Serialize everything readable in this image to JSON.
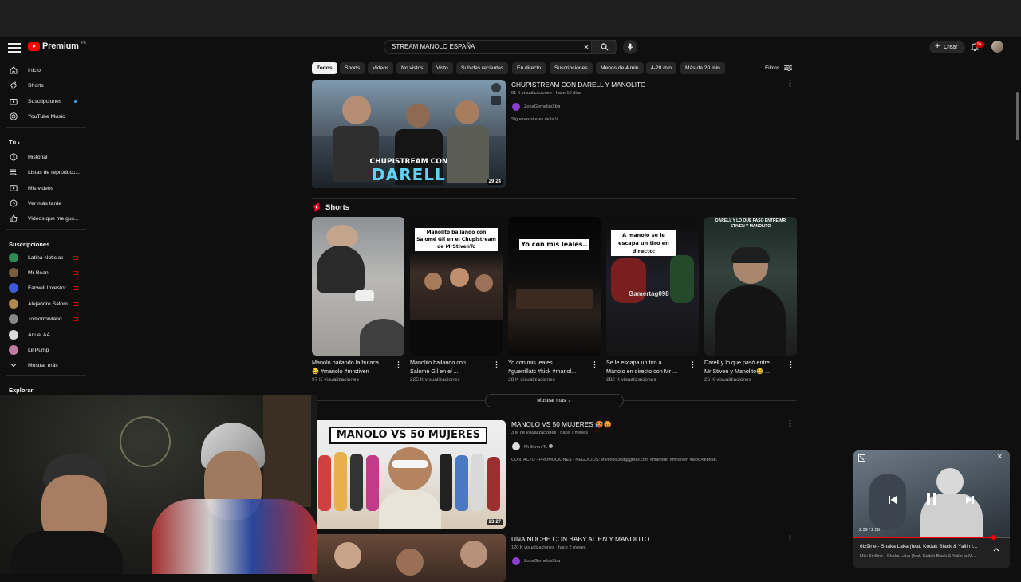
{
  "header": {
    "logo_text": "Premium",
    "country_code": "PE",
    "search_value": "STREAM MANOLO ESPAÑA",
    "create_label": "Crear",
    "notification_count": "9+"
  },
  "sidebar": {
    "main": [
      {
        "label": "Inicio",
        "icon": "home-icon"
      },
      {
        "label": "Shorts",
        "icon": "shorts-icon"
      },
      {
        "label": "Suscripciones",
        "icon": "subscriptions-icon"
      },
      {
        "label": "YouTube Music",
        "icon": "music-icon"
      }
    ],
    "you_heading": "Tú",
    "you": [
      {
        "label": "Historial",
        "icon": "history-icon"
      },
      {
        "label": "Listas de reproducc...",
        "icon": "playlists-icon"
      },
      {
        "label": "Mis videos",
        "icon": "my-videos-icon"
      },
      {
        "label": "Ver más tarde",
        "icon": "watch-later-icon"
      },
      {
        "label": "Videos que me gus...",
        "icon": "liked-icon"
      }
    ],
    "subs_heading": "Suscripciones",
    "subscriptions": [
      {
        "label": "Latina Noticias",
        "color": "#2e8b57"
      },
      {
        "label": "Mr Bean",
        "color": "#7a5c3e"
      },
      {
        "label": "Farwell Investor",
        "color": "#3b5bdb"
      },
      {
        "label": "Alejandro Salom...",
        "color": "#b08a4a"
      },
      {
        "label": "Tomorrowland",
        "color": "#888888"
      },
      {
        "label": "Anuel AA",
        "color": "#d9d9d9"
      },
      {
        "label": "Lil Pump",
        "color": "#c27aa0"
      }
    ],
    "show_more": "Mostrar más",
    "explore_heading": "Explorar"
  },
  "chips": [
    "Todos",
    "Shorts",
    "Videos",
    "No vistos",
    "Visto",
    "Subidas recientes",
    "En directo",
    "Suscripciones",
    "Menos de 4 min",
    "4-20 min",
    "Más de 20 min"
  ],
  "filters_label": "Filtros",
  "results": [
    {
      "title": "CHUPISTREAM CON DARELL Y MANOLITO",
      "views": "61 K visualizaciones",
      "age": "hace 13 días",
      "channel": "ZonaGemelosXtra",
      "description": "Síguenos si eres de la V.",
      "duration": "29:24",
      "thumb_text": "CHUPISTREAM CON",
      "thumb_text_big": "DARELL"
    },
    {
      "title": "MANOLO VS 50 MUJERES 🥵😡",
      "views": "3 M de visualizaciones",
      "age": "hace 7 meses",
      "channel": "MrStiven Tc",
      "description": "CONTACTO - PROMOCIONES - NEGOCIOS: stivenbls30d@gmail.com #manolito #mrstiven #kick #lebriah.",
      "duration": "23:27",
      "thumb_text": "MANOLO VS 50 MUJERES"
    },
    {
      "title": "UNA NOCHE CON BABY ALIEN Y MANOLITO",
      "views": "120 K visualizaciones",
      "age": "hace 2 meses",
      "channel": "ZonaGemelosXtra"
    }
  ],
  "shorts": {
    "heading": "Shorts",
    "items": [
      {
        "title1": "Manolo bailando la butaca",
        "title2": "😂 #manolo #mrstiven",
        "views": "97 K visualizaciones",
        "caption": ""
      },
      {
        "title1": "Manolito bailando con",
        "title2": "Salomé Gil en el ...",
        "views": "225 K visualizaciones",
        "caption": "Manolito bailando con Salomé Gil en el Chupistream de MrStivenTc"
      },
      {
        "title1": "Yo con mis leales..",
        "title2": "#guerrillatc #kick #manol...",
        "views": "38 K visualizaciones",
        "caption": "Yo con mis leales.."
      },
      {
        "title1": "Se le escapa un tiro a",
        "title2": "Manolo en directo con Mr ...",
        "views": "282 K visualizaciones",
        "caption": "A manolo se le escapa un tiro en directo:",
        "watermark": "Gamertag098"
      },
      {
        "title1": "Darell y lo que pasó entre",
        "title2": "Mr Stiven y Manolito😂 ...",
        "views": "26 K visualizaciones",
        "caption": "DARELL Y LO QUE PASÓ ENTRE MR STIVEN Y MANOLITO"
      }
    ],
    "show_more": "Mostrar más"
  },
  "miniplayer": {
    "time": "2:39 / 2:56",
    "progress": 0.9,
    "title": "6ix9ine - Shaka Laka (feat. Kodak Black & Yailin l...",
    "subtitle": "Mix: 6ix9ine - Shaka Laka (feat. Kodak Black & Yailin la M..."
  }
}
